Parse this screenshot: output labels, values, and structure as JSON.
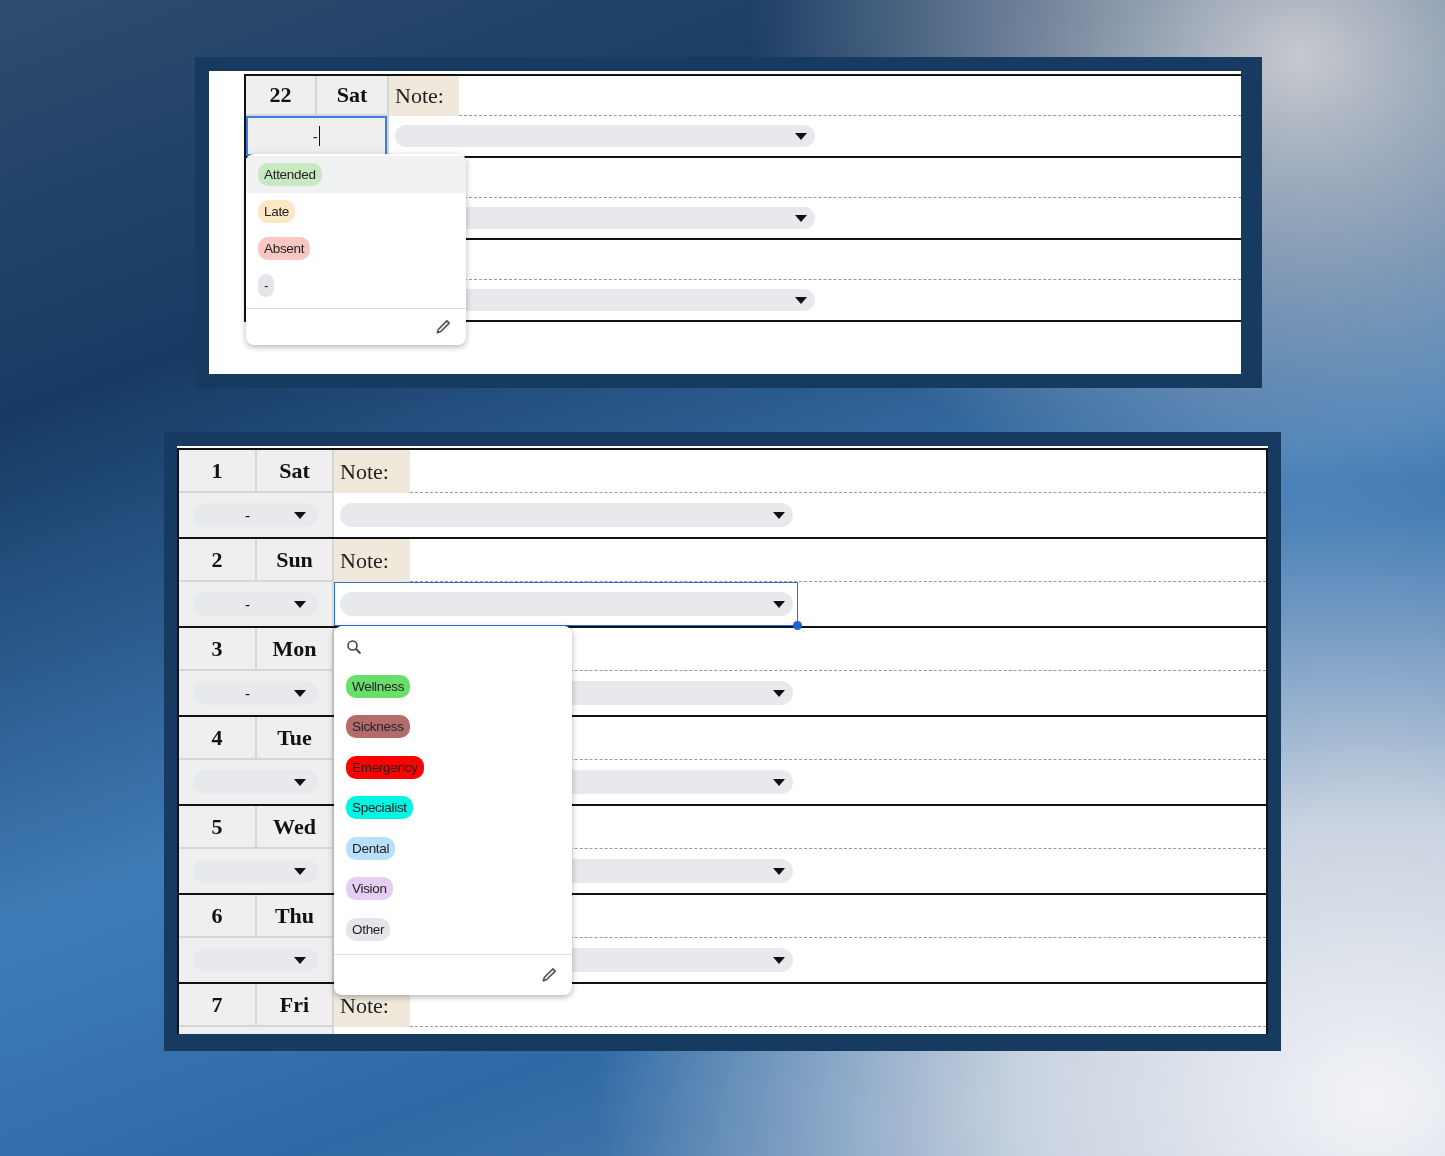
{
  "panels": [
    {
      "rows": [
        {
          "day_number": "22",
          "weekday": "Sat",
          "note_label": "Note:",
          "status": {
            "kind": "input",
            "value": "-",
            "focused": true,
            "menu": {
              "search": false,
              "options": [
                {
                  "label": "Attended",
                  "color": "#c8e8bf",
                  "highlighted": true
                },
                {
                  "label": "Late",
                  "color": "#fde8c4",
                  "highlighted": false
                },
                {
                  "label": "Absent",
                  "color": "#f8c7c3",
                  "highlighted": false
                },
                {
                  "label": "-",
                  "color": "#e5e6ea",
                  "highlighted": false
                }
              ]
            }
          },
          "note_select": {
            "focused": false
          }
        },
        {
          "note_select": {
            "focused": false
          }
        },
        {
          "note_select": {
            "focused": false
          }
        }
      ]
    },
    {
      "rows": [
        {
          "day_number": "1",
          "weekday": "Sat",
          "note_label": "Note:",
          "status": {
            "kind": "dropdown",
            "value": "-",
            "focused": false
          },
          "note_select": {
            "focused": false
          }
        },
        {
          "day_number": "2",
          "weekday": "Sun",
          "note_label": "Note:",
          "status": {
            "kind": "dropdown",
            "value": "-",
            "focused": false
          },
          "note_select": {
            "focused": true,
            "menu": {
              "search": true,
              "options": [
                {
                  "label": "Wellness",
                  "color": "#6ade6a",
                  "highlighted": false
                },
                {
                  "label": "Sickness",
                  "color": "#b46b6b",
                  "highlighted": false
                },
                {
                  "label": "Emergency",
                  "color": "#ff0000",
                  "highlighted": false
                },
                {
                  "label": "Specialist",
                  "color": "#00f5e4",
                  "highlighted": false
                },
                {
                  "label": "Dental",
                  "color": "#b8e0fb",
                  "highlighted": false
                },
                {
                  "label": "Vision",
                  "color": "#e5cdf3",
                  "highlighted": false
                },
                {
                  "label": "Other",
                  "color": "#e5e6ea",
                  "highlighted": false
                }
              ]
            }
          }
        },
        {
          "day_number": "3",
          "weekday": "Mon",
          "status": {
            "kind": "dropdown",
            "value": "-",
            "focused": false
          },
          "note_select": {
            "focused": false
          }
        },
        {
          "day_number": "4",
          "weekday": "Tue",
          "status": {
            "kind": "dropdown",
            "focused": false
          },
          "note_select": {
            "focused": false
          }
        },
        {
          "day_number": "5",
          "weekday": "Wed",
          "status": {
            "kind": "dropdown",
            "focused": false
          },
          "note_select": {
            "focused": false
          }
        },
        {
          "day_number": "6",
          "weekday": "Thu",
          "status": {
            "kind": "dropdown",
            "focused": false
          },
          "note_select": {
            "focused": false
          }
        },
        {
          "day_number": "7",
          "weekday": "Fri",
          "note_label": "Note:"
        }
      ]
    }
  ]
}
